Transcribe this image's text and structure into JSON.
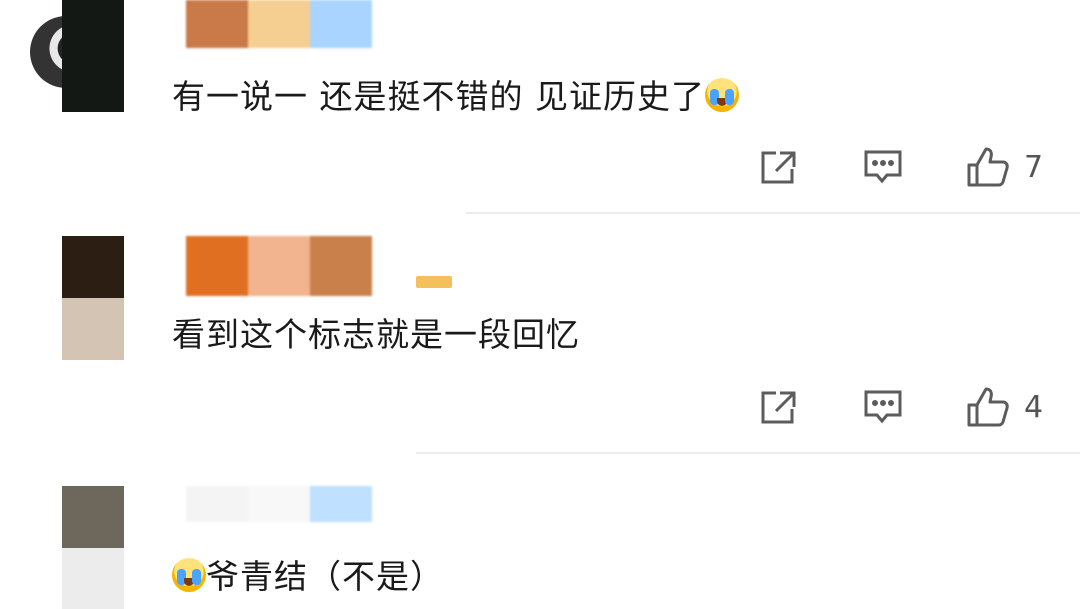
{
  "comments": [
    {
      "text": "有一说一 还是挺不错的 见证历史了",
      "trailing_emoji": "crying-face-emoji",
      "like_count": "7"
    },
    {
      "text": "看到这个标志就是一段回忆",
      "like_count": "4"
    },
    {
      "leading_emoji": "crying-face-emoji",
      "text": "爷青结（不是）"
    }
  ],
  "icons": {
    "share": "share-icon",
    "reply": "comment-icon",
    "like": "thumbs-up-icon"
  },
  "colors": {
    "text": "#1a1a1a",
    "icon": "#5c5c5c",
    "divider": "#ececec"
  }
}
